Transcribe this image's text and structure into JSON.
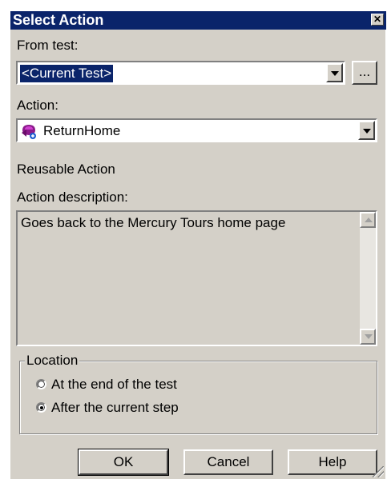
{
  "dialog": {
    "title": "Select Action",
    "close_glyph": "✕"
  },
  "from_test": {
    "label": "From test:",
    "value": "<Current Test>",
    "browse_label": "..."
  },
  "action": {
    "label": "Action:",
    "value": "ReturnHome",
    "icon": "reusable-action-icon"
  },
  "reusable_text": "Reusable Action",
  "description": {
    "label": "Action description:",
    "text": "Goes back to the Mercury Tours home page"
  },
  "location": {
    "legend": "Location",
    "options": [
      {
        "label": "At the end of the test",
        "checked": false
      },
      {
        "label": "After the current step",
        "checked": true
      }
    ]
  },
  "buttons": {
    "ok": "OK",
    "cancel": "Cancel",
    "help": "Help"
  }
}
